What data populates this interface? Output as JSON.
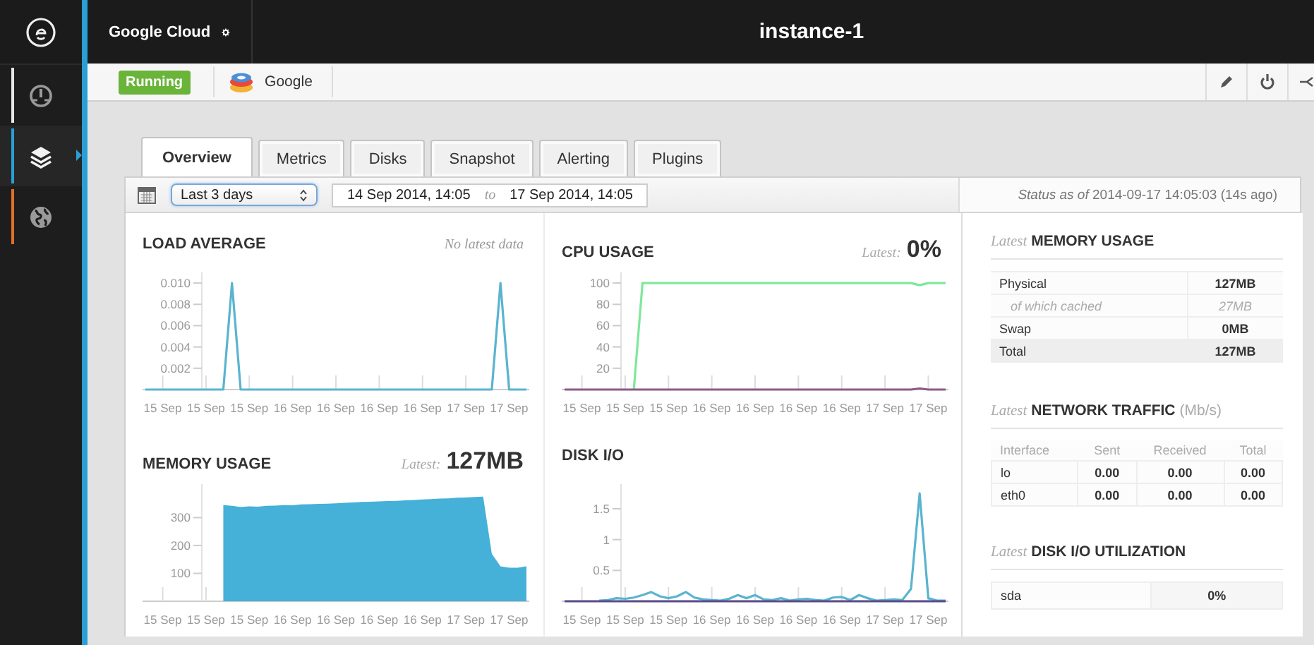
{
  "sidebar": {
    "items": [
      {
        "selected": false,
        "color": "#e6e6e6"
      },
      {
        "selected": true,
        "color": "#2a9fd6"
      },
      {
        "selected": false,
        "color": "#e0702a"
      }
    ]
  },
  "topbar": {
    "account": "Google Cloud",
    "title": "instance-1"
  },
  "toolbar": {
    "status": "Running",
    "provider": "Google"
  },
  "tabs": [
    {
      "label": "Overview",
      "selected": true
    },
    {
      "label": "Metrics",
      "selected": false
    },
    {
      "label": "Disks",
      "selected": false
    },
    {
      "label": "Snapshot",
      "selected": false
    },
    {
      "label": "Alerting",
      "selected": false
    },
    {
      "label": "Plugins",
      "selected": false
    }
  ],
  "range": {
    "preset": "Last 3 days",
    "from": "14 Sep 2014, 14:05",
    "separator": "to",
    "to": "17 Sep 2014, 14:05"
  },
  "status": "*Status as of* 2014-09-17 14:05:03 (14s ago)",
  "charts": [
    {
      "note": "No latest data",
      "chart_data": {
        "type": "line",
        "title": "LOAD AVERAGE",
        "categories": [
          null,
          null,
          "15 Sep",
          null,
          null,
          null,
          null,
          "15 Sep",
          null,
          null,
          null,
          null,
          "15 Sep",
          null,
          null,
          null,
          null,
          "16 Sep",
          null,
          null,
          null,
          null,
          "16 Sep",
          null,
          null,
          null,
          null,
          "16 Sep",
          null,
          null,
          null,
          null,
          "16 Sep",
          null,
          null,
          null,
          null,
          "17 Sep",
          null,
          null,
          null,
          null,
          "17 Sep",
          null,
          null
        ],
        "ylim": [
          0,
          0.011
        ],
        "yticks": [
          {
            "value": 0.002,
            "label": "0.002"
          },
          {
            "value": 0.004,
            "label": "0.004"
          },
          {
            "value": 0.006,
            "label": "0.006"
          },
          {
            "value": 0.008,
            "label": "0.008"
          },
          {
            "value": 0.01,
            "label": "0.010"
          }
        ],
        "series": [
          {
            "color": "#5ab4cf",
            "values": [
              0,
              0,
              0,
              0,
              0,
              0,
              0,
              0,
              0,
              0,
              0.01,
              0,
              0,
              0,
              0,
              0,
              0,
              0,
              0,
              0,
              0,
              0,
              0,
              0,
              0,
              0,
              0,
              0,
              0,
              0,
              0,
              0,
              0,
              0,
              0,
              0,
              0,
              0,
              0,
              0,
              0,
              0.01,
              0,
              0,
              0
            ]
          }
        ]
      }
    },
    {
      "latest_label": "Latest:",
      "latest_value": "0%",
      "chart_data": {
        "type": "line",
        "title": "CPU USAGE",
        "categories": [
          null,
          null,
          "15 Sep",
          null,
          null,
          null,
          null,
          "15 Sep",
          null,
          null,
          null,
          null,
          "15 Sep",
          null,
          null,
          null,
          null,
          "16 Sep",
          null,
          null,
          null,
          null,
          "16 Sep",
          null,
          null,
          null,
          null,
          "16 Sep",
          null,
          null,
          null,
          null,
          "16 Sep",
          null,
          null,
          null,
          null,
          "17 Sep",
          null,
          null,
          null,
          null,
          "17 Sep",
          null,
          null
        ],
        "ylim": [
          0,
          110
        ],
        "yticks": [
          {
            "value": 20,
            "label": "20"
          },
          {
            "value": 40,
            "label": "40"
          },
          {
            "value": 60,
            "label": "60"
          },
          {
            "value": 80,
            "label": "80"
          },
          {
            "value": 100,
            "label": "100"
          }
        ],
        "series": [
          {
            "color": "#7ee89a",
            "values": [
              null,
              null,
              null,
              null,
              null,
              null,
              null,
              null,
              0,
              100,
              100,
              100,
              100,
              100,
              100,
              100,
              100,
              100,
              100,
              100,
              100,
              100,
              100,
              100,
              100,
              100,
              100,
              100,
              100,
              100,
              100,
              100,
              100,
              100,
              100,
              100,
              100,
              100,
              100,
              100,
              100,
              98,
              100,
              100,
              100
            ]
          },
          {
            "color": "#8b5a8a",
            "values": [
              0,
              0,
              0,
              0,
              0,
              0,
              0,
              0,
              0,
              0,
              0,
              0,
              0,
              0,
              0,
              0,
              0,
              0,
              0,
              0,
              0,
              0,
              0,
              0,
              0,
              0,
              0,
              0,
              0,
              0,
              0,
              0,
              0,
              0,
              0,
              0,
              0,
              0,
              0,
              0,
              0,
              1,
              0,
              0,
              0
            ]
          }
        ]
      }
    },
    {
      "latest_label": "Latest:",
      "latest_value": "127MB",
      "chart_data": {
        "type": "area",
        "title": "MEMORY USAGE",
        "categories": [
          null,
          null,
          "15 Sep",
          null,
          null,
          null,
          null,
          "15 Sep",
          null,
          null,
          null,
          null,
          "15 Sep",
          null,
          null,
          null,
          null,
          "16 Sep",
          null,
          null,
          null,
          null,
          "16 Sep",
          null,
          null,
          null,
          null,
          "16 Sep",
          null,
          null,
          null,
          null,
          "16 Sep",
          null,
          null,
          null,
          null,
          "17 Sep",
          null,
          null,
          null,
          null,
          "17 Sep",
          null,
          null
        ],
        "ylim": [
          0,
          420
        ],
        "yticks": [
          {
            "value": 100,
            "label": "100"
          },
          {
            "value": 200,
            "label": "200"
          },
          {
            "value": 300,
            "label": "300"
          }
        ],
        "series": [
          {
            "color": "#45b0d8",
            "values": [
              null,
              null,
              null,
              null,
              null,
              null,
              null,
              null,
              null,
              345,
              342,
              338,
              340,
              339,
              342,
              343,
              345,
              344,
              347,
              348,
              349,
              350,
              351,
              353,
              354,
              356,
              357,
              358,
              359,
              360,
              362,
              363,
              365,
              366,
              368,
              369,
              371,
              372,
              374,
              375,
              170,
              125,
              120,
              120,
              125
            ]
          }
        ]
      }
    },
    {
      "chart_data": {
        "type": "line",
        "title": "DISK I/O",
        "categories": [
          null,
          null,
          "15 Sep",
          null,
          null,
          null,
          null,
          "15 Sep",
          null,
          null,
          null,
          null,
          "15 Sep",
          null,
          null,
          null,
          null,
          "16 Sep",
          null,
          null,
          null,
          null,
          "16 Sep",
          null,
          null,
          null,
          null,
          "16 Sep",
          null,
          null,
          null,
          null,
          "16 Sep",
          null,
          null,
          null,
          null,
          "17 Sep",
          null,
          null,
          null,
          null,
          "17 Sep",
          null,
          null
        ],
        "ylim": [
          0,
          1.9
        ],
        "yticks": [
          {
            "value": 0.5,
            "label": "0.5"
          },
          {
            "value": 1,
            "label": "1"
          },
          {
            "value": 1.5,
            "label": "1.5"
          }
        ],
        "series": [
          {
            "color": "#5ab4cf",
            "values": [
              null,
              null,
              null,
              null,
              0.01,
              0.02,
              0.05,
              0.04,
              0.06,
              0.1,
              0.15,
              0.08,
              0.05,
              0.08,
              0.15,
              0.06,
              0.03,
              0.02,
              0.01,
              0.04,
              0.1,
              0.05,
              0.1,
              0.03,
              0.02,
              0.05,
              0.01,
              0.03,
              0.04,
              0.02,
              0.01,
              0.06,
              0.07,
              0.02,
              0.1,
              0.05,
              0.01,
              0.02,
              0.03,
              0.02,
              0.2,
              1.75,
              0.05,
              0.01,
              0.01
            ]
          },
          {
            "color": "#5a4a8a",
            "values": [
              0,
              0,
              0,
              0,
              0,
              0,
              0,
              0,
              0,
              0,
              0,
              0,
              0,
              0,
              0,
              0,
              0,
              0,
              0,
              0,
              0,
              0,
              0,
              0,
              0,
              0,
              0,
              0,
              0,
              0,
              0,
              0,
              0,
              0,
              0,
              0,
              0,
              0,
              0,
              0,
              0,
              0,
              0,
              0,
              0
            ]
          }
        ]
      }
    }
  ],
  "summary": {
    "memory": {
      "prefix": "Latest",
      "title": "MEMORY USAGE",
      "rows": [
        {
          "kind": "main",
          "label": "Physical",
          "value": "127MB"
        },
        {
          "kind": "sub",
          "label": "of which cached",
          "value": "27MB"
        },
        {
          "kind": "main",
          "label": "Swap",
          "value": "0MB"
        },
        {
          "kind": "total",
          "label": "Total",
          "value": "127MB"
        }
      ]
    },
    "network": {
      "prefix": "Latest",
      "title": "NETWORK TRAFFIC",
      "unit": "(Mb/s)",
      "columns": [
        "Interface",
        "Sent",
        "Received",
        "Total"
      ],
      "rows": [
        [
          "lo",
          "0.00",
          "0.00",
          "0.00"
        ],
        [
          "eth0",
          "0.00",
          "0.00",
          "0.00"
        ]
      ]
    },
    "disk": {
      "prefix": "Latest",
      "title": "DISK I/O UTILIZATION",
      "rows": [
        [
          "sda",
          "0%"
        ]
      ]
    }
  }
}
